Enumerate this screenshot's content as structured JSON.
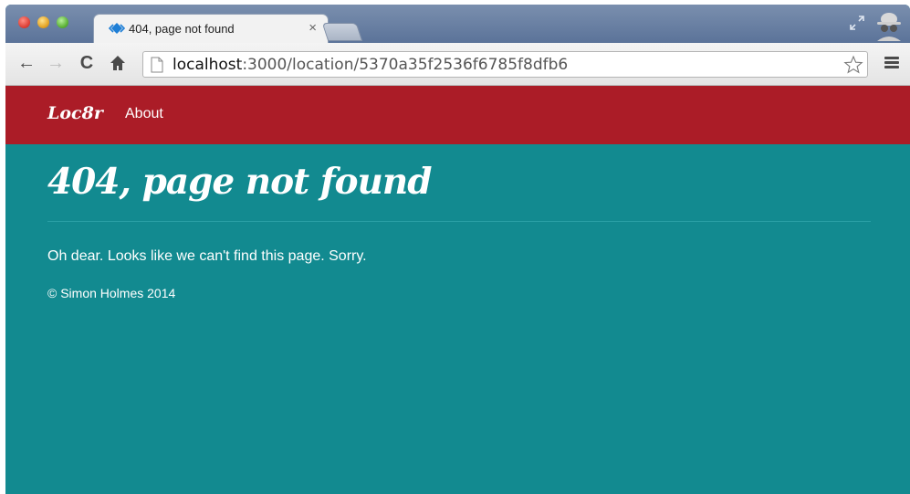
{
  "browser": {
    "tab": {
      "title": "404, page not found",
      "close_glyph": "×",
      "favicon": "code-diamond-icon"
    },
    "address": {
      "host": "localhost",
      "path": ":3000/location/5370a35f2536f6785f8dfb6"
    },
    "icons": {
      "back": "←",
      "forward": "→",
      "reload": "C",
      "home": "home-icon"
    }
  },
  "site": {
    "brand": "Loc8r",
    "nav": {
      "about": "About"
    },
    "colors": {
      "navbar": "#ab1c27",
      "background": "#128a90"
    }
  },
  "page": {
    "title": "404, page not found",
    "message": "Oh dear. Looks like we can't find this page. Sorry.",
    "footer": "© Simon Holmes 2014"
  }
}
